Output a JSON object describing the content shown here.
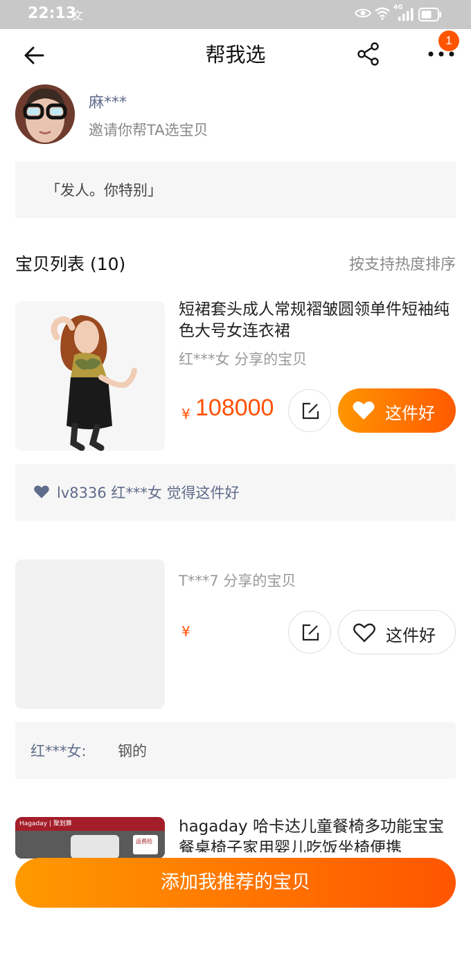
{
  "status_bar": {
    "time": "22:13",
    "lang_icon": "文",
    "network": "4G"
  },
  "nav": {
    "title": "帮我选",
    "badge": "1"
  },
  "user": {
    "name": "麻***",
    "invite_text": "邀请你帮TA选宝贝"
  },
  "quote": "「发人。你特别」",
  "list": {
    "title": "宝贝列表 (10)",
    "sort_label": "按支持热度排序"
  },
  "products": [
    {
      "title": "短裙套头成人常规褶皱圆领单件短袖纯色大号女连衣裙",
      "sharer": "红***女 分享的宝贝",
      "currency": "¥",
      "price": "108000",
      "good_label": "这件好",
      "comment": "lv8336  红***女 觉得这件好"
    },
    {
      "title": "",
      "sharer": "T***7 分享的宝贝",
      "currency": "¥",
      "price": "",
      "good_label": "这件好",
      "comment_name": "红***女:",
      "comment_body": "钢的"
    },
    {
      "title": "hagaday 哈卡达儿童餐椅多功能宝宝餐桌椅子家用婴儿吃饭坐椅便携",
      "brand_text": "Hagaday | 聚划算",
      "tag_text": "运费险"
    }
  ],
  "bottom_button": "添加我推荐的宝贝",
  "colors": {
    "accent": "#ff5000",
    "gradient_start": "#ff9a00",
    "gradient_end": "#ff5500",
    "muted_blue": "#5f6b8a"
  }
}
